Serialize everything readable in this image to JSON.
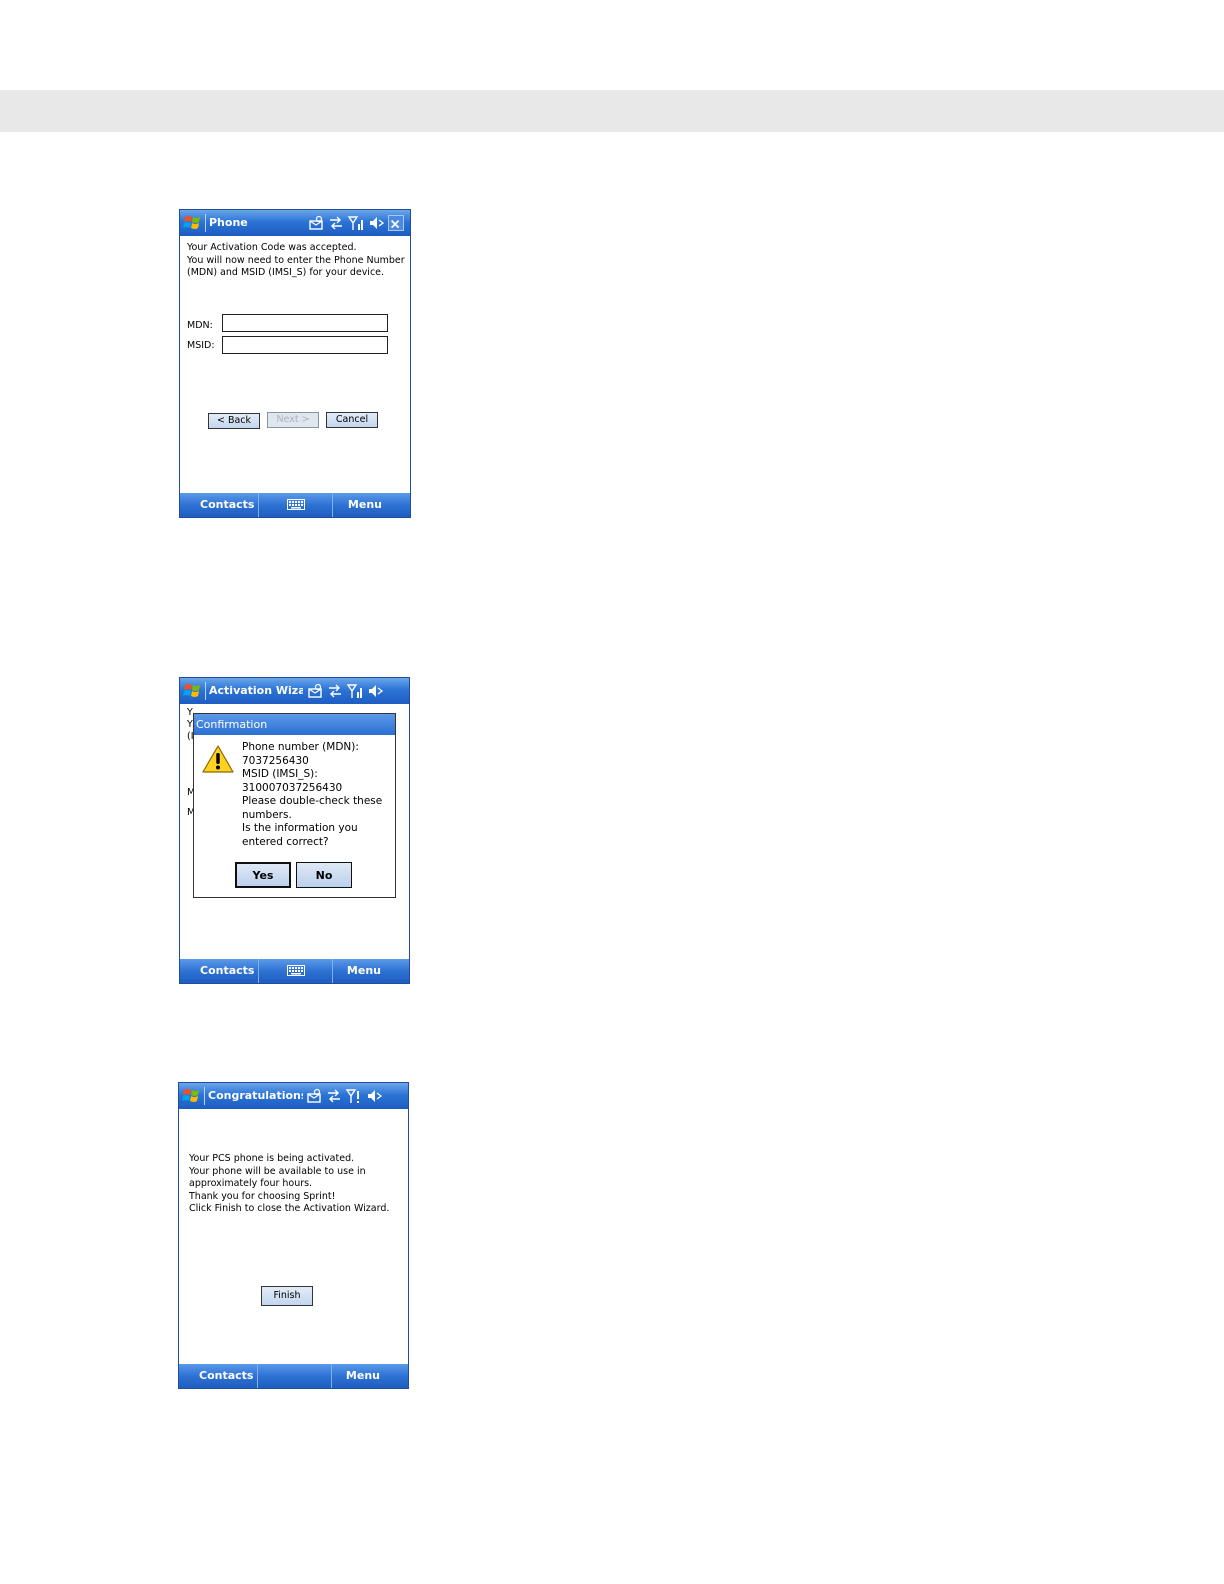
{
  "screens": {
    "phone": {
      "title": "Phone",
      "lines": [
        "Your Activation Code was accepted.",
        "You will now need to enter the Phone Number",
        "(MDN) and MSID (IMSI_S) for your device."
      ],
      "mdn_label": "MDN:",
      "msid_label": "MSID:",
      "mdn_value": "",
      "msid_value": "",
      "back_label": "< Back",
      "next_label": "Next >",
      "cancel_label": "Cancel",
      "softkey_left": "Contacts",
      "softkey_right": "Menu"
    },
    "confirm": {
      "title": "Activation Wizard",
      "dialog_title": "Confirmation",
      "bg_fragments": [
        "Y",
        "Y",
        "(I",
        "M",
        "M"
      ],
      "dialog_lines": [
        "Phone number (MDN):",
        "7037256430",
        "MSID (IMSI_S):",
        "310007037256430",
        "Please double-check these",
        "numbers.",
        "Is the information you",
        "entered correct?"
      ],
      "yes_label": "Yes",
      "no_label": "No",
      "softkey_left": "Contacts",
      "softkey_right": "Menu"
    },
    "congrats": {
      "title": "Congratulations!",
      "lines": [
        "Your PCS phone is being activated.",
        "Your phone will be available to use in",
        "approximately four hours.",
        "Thank you for choosing Sprint!",
        "Click Finish to close the Activation Wizard."
      ],
      "finish_label": "Finish",
      "softkey_left": "Contacts",
      "softkey_right": "Menu"
    }
  },
  "icons": {
    "start": "windows-flag-icon",
    "messaging": "new-message-icon",
    "connectivity": "sync-arrows-icon",
    "signal": "signal-strength-icon",
    "volume": "speaker-muted-icon",
    "close": "close-icon",
    "keyboard": "keyboard-icon",
    "warning": "warning-icon"
  },
  "colors": {
    "titlebar": "#2c74d6",
    "softbar": "#2e72d4",
    "header_band": "#e8e8e8"
  }
}
